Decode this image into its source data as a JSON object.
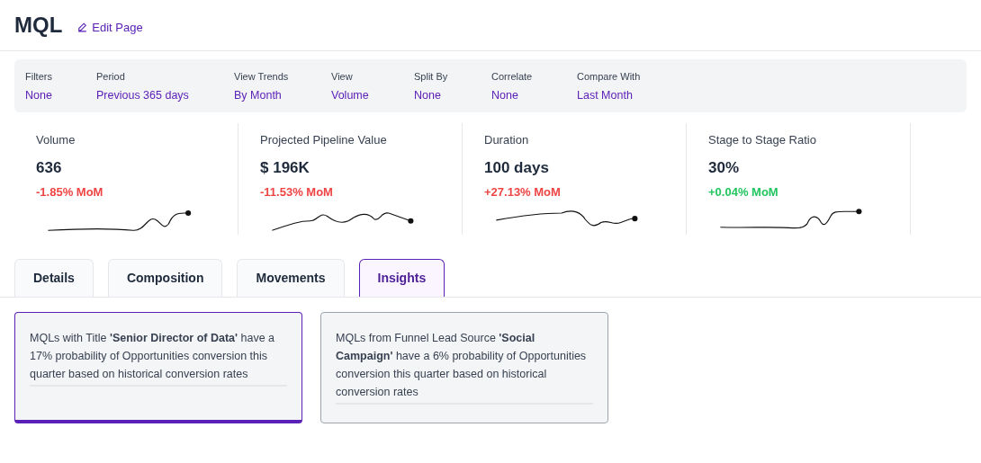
{
  "header": {
    "title": "MQL",
    "edit_link": "Edit Page"
  },
  "filters": [
    {
      "label": "Filters",
      "value": "None"
    },
    {
      "label": "Period",
      "value": "Previous 365 days"
    },
    {
      "label": "View Trends",
      "value": "By Month"
    },
    {
      "label": "View",
      "value": "Volume"
    },
    {
      "label": "Split By",
      "value": "None"
    },
    {
      "label": "Correlate",
      "value": "None"
    },
    {
      "label": "Compare With",
      "value": "Last Month"
    }
  ],
  "metrics": [
    {
      "label": "Volume",
      "value": "636",
      "change": "-1.85% MoM",
      "color": "#ef4444"
    },
    {
      "label": "Projected Pipeline Value",
      "value": "$ 196K",
      "change": "-11.53% MoM",
      "color": "#ef4444"
    },
    {
      "label": "Duration",
      "value": "100 days",
      "change": "+27.13% MoM",
      "color": "#ef4444"
    },
    {
      "label": "Stage to Stage Ratio",
      "value": "30%",
      "change": "+0.04% MoM",
      "color": "#22c55e"
    }
  ],
  "tabs": [
    {
      "label": "Details",
      "selected": false
    },
    {
      "label": "Composition",
      "selected": false
    },
    {
      "label": "Movements",
      "selected": false
    },
    {
      "label": "Insights",
      "selected": true
    }
  ],
  "insights": [
    {
      "text": "MQLs with Title **'Senior Director of Data'** have a 17% probability of Opportunities conversion this quarter based on historical conversion rates",
      "selected": true
    },
    {
      "text": "MQLs from Funnel Lead Source **'Social Campaign'** have a 6% probability of Opportunities conversion this quarter based on historical conversion rates",
      "selected": false
    }
  ]
}
